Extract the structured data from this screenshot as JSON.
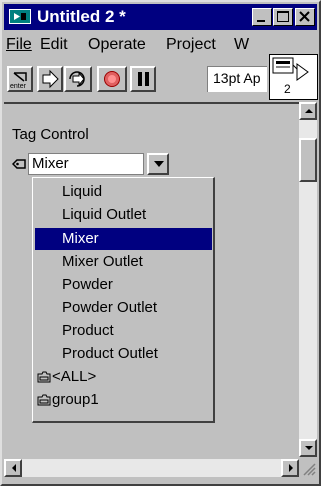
{
  "window": {
    "title": "Untitled 2 *"
  },
  "menubar": {
    "file": "File",
    "edit": "Edit",
    "operate": "Operate",
    "project": "Project",
    "partial": "W"
  },
  "toolbar": {
    "enter_label": "enter",
    "font_value": "13pt Ap"
  },
  "vi_icon": {
    "number": "2"
  },
  "panel": {
    "tag_control_label": "Tag Control",
    "tag_value": "Mixer",
    "dropdown_items": [
      "Liquid",
      "Liquid Outlet",
      "Mixer",
      "Mixer Outlet",
      "Powder",
      "Powder Outlet",
      "Product",
      "Product Outlet",
      "<ALL>",
      "group1"
    ],
    "selected_item": "Mixer"
  },
  "colors": {
    "title_bar": "#000080",
    "selection": "#000080",
    "face": "#c0c0c0"
  },
  "icons": [
    "labview-app-icon",
    "minimize-icon",
    "maximize-icon",
    "close-icon",
    "run-arrow-icon",
    "run-continuous-icon",
    "abort-icon",
    "pause-icon",
    "tag-icon",
    "folder-icon",
    "dropdown-arrow-icon"
  ]
}
